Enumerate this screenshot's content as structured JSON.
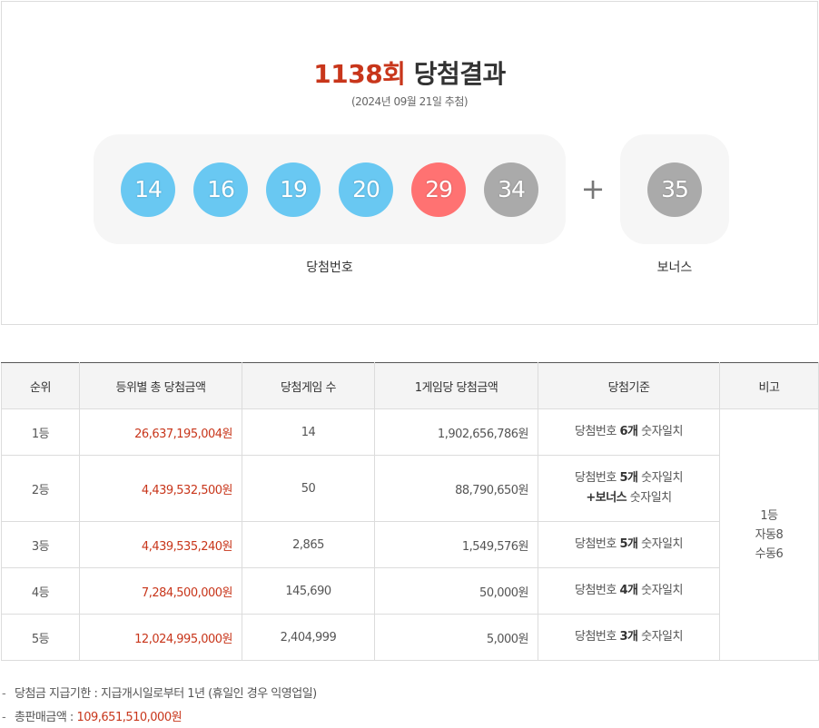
{
  "header": {
    "round": "1138회",
    "title_suffix": "당첨결과",
    "draw_date": "(2024년 09월 21일 추첨)"
  },
  "winning": {
    "caption": "당첨번호",
    "balls": [
      {
        "number": "14",
        "color": "#69c8f2"
      },
      {
        "number": "16",
        "color": "#69c8f2"
      },
      {
        "number": "19",
        "color": "#69c8f2"
      },
      {
        "number": "20",
        "color": "#69c8f2"
      },
      {
        "number": "29",
        "color": "#ff7272"
      },
      {
        "number": "34",
        "color": "#aaaaaa"
      }
    ]
  },
  "bonus": {
    "caption": "보너스",
    "plus": "+",
    "ball": {
      "number": "35",
      "color": "#aaaaaa"
    }
  },
  "table": {
    "headers": [
      "순위",
      "등위별 총 당첨금액",
      "당첨게임 수",
      "1게임당 당첨금액",
      "당첨기준",
      "비고"
    ],
    "rows": [
      {
        "rank": "1등",
        "total": "26,637,195,004원",
        "games": "14",
        "per_game": "1,902,656,786원",
        "crit_a": "당첨번호 ",
        "crit_b": "6개",
        "crit_c": " 숫자일치"
      },
      {
        "rank": "2등",
        "total": "4,439,532,500원",
        "games": "50",
        "per_game": "88,790,650원",
        "crit_a": "당첨번호 ",
        "crit_b": "5개",
        "crit_c": " 숫자일치",
        "crit_d": "+보너스",
        "crit_e": " 숫자일치"
      },
      {
        "rank": "3등",
        "total": "4,439,535,240원",
        "games": "2,865",
        "per_game": "1,549,576원",
        "crit_a": "당첨번호 ",
        "crit_b": "5개",
        "crit_c": " 숫자일치"
      },
      {
        "rank": "4등",
        "total": "7,284,500,000원",
        "games": "145,690",
        "per_game": "50,000원",
        "crit_a": "당첨번호 ",
        "crit_b": "4개",
        "crit_c": " 숫자일치"
      },
      {
        "rank": "5등",
        "total": "12,024,995,000원",
        "games": "2,404,999",
        "per_game": "5,000원",
        "crit_a": "당첨번호 ",
        "crit_b": "3개",
        "crit_c": " 숫자일치"
      }
    ],
    "note": [
      "1등",
      "자동8",
      "수동6"
    ]
  },
  "footnotes": {
    "dash": "-",
    "deadline": "당첨금 지급기한 : 지급개시일로부터 1년 (휴일인 경우 익영업일)",
    "sales_label": "총판매금액 : ",
    "sales_value": "109,651,510,000원"
  }
}
